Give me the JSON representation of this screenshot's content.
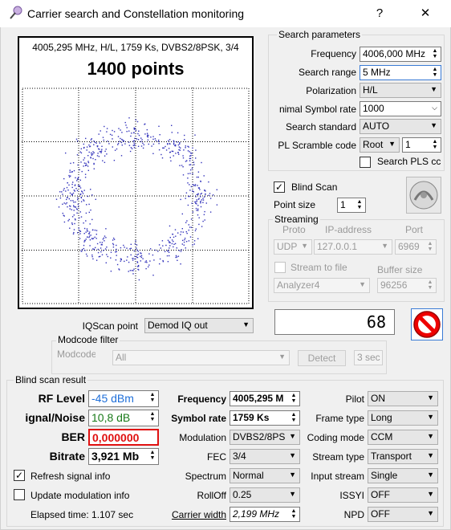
{
  "window": {
    "title": "Carrier search and Constellation monitoring",
    "help": "?",
    "close": "✕"
  },
  "scope": {
    "info": "4005,295 MHz, H/L, 1759 Ks, DVBS2/8PSK, 3/4",
    "points_label": "1400 points"
  },
  "search": {
    "title": "Search parameters",
    "frequency_label": "Frequency",
    "frequency_value": "4006,000 MHz",
    "range_label": "Search range",
    "range_value": "5 MHz",
    "polarization_label": "Polarization",
    "polarization_value": "H/L",
    "symrate_label": "nimal Symbol rate",
    "symrate_value": "1000",
    "standard_label": "Search standard",
    "standard_value": "AUTO",
    "pls_label": "PL Scramble code",
    "pls_mode": "Root",
    "pls_value": "1",
    "search_pls_label": "Search PLS cc"
  },
  "blind": {
    "label": "Blind Scan",
    "point_size_label": "Point size",
    "point_size_value": "1"
  },
  "streaming": {
    "title": "Streaming",
    "proto_label": "Proto",
    "ip_label": "IP-address",
    "port_label": "Port",
    "proto_value": "UDP",
    "ip_value": "127.0.0.1",
    "port_value": "6969",
    "stream_to_file_label": "Stream to file",
    "buffer_label": "Buffer size",
    "analyzer_value": "Analyzer4",
    "buffer_value": "96256"
  },
  "lcd_value": "68",
  "iq": {
    "label": "IQScan point",
    "value": "Demod IQ out"
  },
  "modcode": {
    "title": "Modcode filter",
    "label": "Modcode",
    "value": "All",
    "detect": "Detect",
    "sec": "3 sec"
  },
  "result": {
    "title": "Blind scan result",
    "rf_label": "RF Level",
    "rf_value": "-45 dBm",
    "sn_label": "ignal/Noise",
    "sn_value": "10,8 dB",
    "ber_label": "BER",
    "ber_value": "0,000000",
    "bitrate_label": "Bitrate",
    "bitrate_value": "3,921 Mb",
    "refresh_label": "Refresh signal info",
    "update_label": "Update modulation info",
    "elapsed": "Elapsed time: 1.107 sec",
    "freq_label": "Frequency",
    "freq_value": "4005,295 M",
    "sr_label": "Symbol rate",
    "sr_value": "1759 Ks",
    "mod_label": "Modulation",
    "mod_value": "DVBS2/8PS",
    "fec_label": "FEC",
    "fec_value": "3/4",
    "spectrum_label": "Spectrum",
    "spectrum_value": "Normal",
    "rolloff_label": "RollOff",
    "rolloff_value": "0.25",
    "cw_label": "Carrier width",
    "cw_value": "2,199 MHz",
    "pilot_label": "Pilot",
    "pilot_value": "ON",
    "frame_label": "Frame type",
    "frame_value": "Long",
    "coding_label": "Coding mode",
    "coding_value": "CCM",
    "stype_label": "Stream type",
    "stype_value": "Transport",
    "istream_label": "Input stream",
    "istream_value": "Single",
    "issyi_label": "ISSYI",
    "issyi_value": "OFF",
    "npd_label": "NPD",
    "npd_value": "OFF"
  },
  "colors": {
    "rf": "#1e6fd9",
    "sn": "#1a7a1a",
    "ber": "#e01010",
    "points": "#3333bb"
  }
}
